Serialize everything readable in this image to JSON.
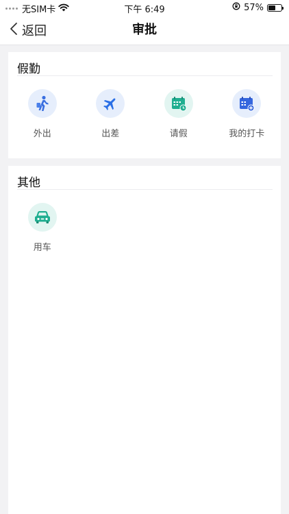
{
  "status_bar": {
    "carrier": "无SIM卡",
    "time": "下午 6:49",
    "battery_percent": "57%",
    "battery_level": 0.57
  },
  "nav": {
    "back_label": "返回",
    "title": "审批"
  },
  "sections": [
    {
      "title": "假勤",
      "items": [
        {
          "label": "外出",
          "icon": "walking-person-icon",
          "color": "#3a6fe0"
        },
        {
          "label": "出差",
          "icon": "airplane-icon",
          "color": "#2a6fe6"
        },
        {
          "label": "请假",
          "icon": "calendar-clock-icon",
          "color": "#1fae90"
        },
        {
          "label": "我的打卡",
          "icon": "punch-card-icon",
          "color": "#3566de"
        }
      ]
    },
    {
      "title": "其他",
      "items": [
        {
          "label": "用车",
          "icon": "car-icon",
          "color": "#1fae90"
        }
      ]
    }
  ]
}
